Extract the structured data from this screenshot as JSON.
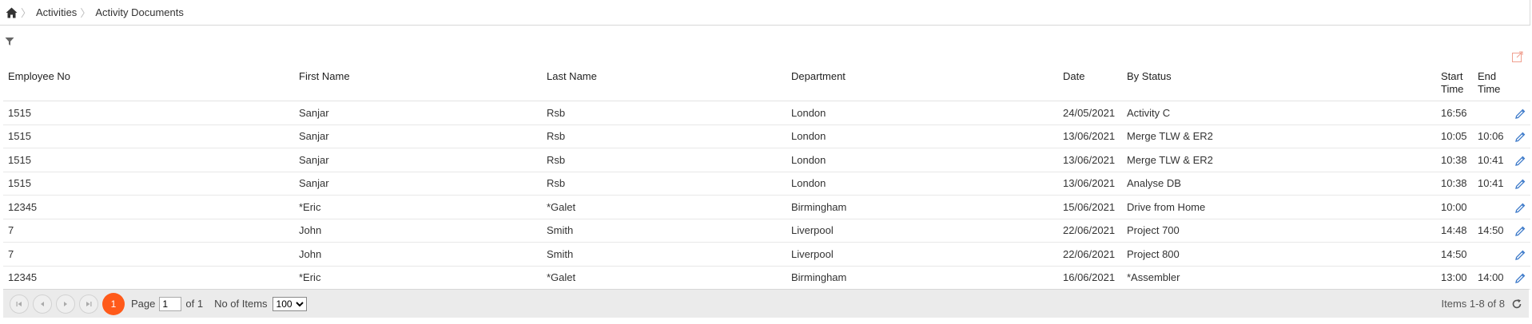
{
  "breadcrumb": {
    "items": [
      "Activities",
      "Activity Documents"
    ]
  },
  "table": {
    "headers": {
      "employee_no": "Employee No",
      "first_name": "First Name",
      "last_name": "Last Name",
      "department": "Department",
      "date": "Date",
      "by_status": "By Status",
      "start_time_1": "Start",
      "start_time_2": "Time",
      "end_time_1": "End",
      "end_time_2": "Time"
    },
    "rows": [
      {
        "emp": "1515",
        "first": "Sanjar",
        "last": "Rsb",
        "dept": "London",
        "date": "24/05/2021",
        "status": "Activity C",
        "start": "16:56",
        "end": ""
      },
      {
        "emp": "1515",
        "first": "Sanjar",
        "last": "Rsb",
        "dept": "London",
        "date": "13/06/2021",
        "status": "Merge TLW & ER2",
        "start": "10:05",
        "end": "10:06"
      },
      {
        "emp": "1515",
        "first": "Sanjar",
        "last": "Rsb",
        "dept": "London",
        "date": "13/06/2021",
        "status": "Merge TLW & ER2",
        "start": "10:38",
        "end": "10:41"
      },
      {
        "emp": "1515",
        "first": "Sanjar",
        "last": "Rsb",
        "dept": "London",
        "date": "13/06/2021",
        "status": "Analyse DB",
        "start": "10:38",
        "end": "10:41"
      },
      {
        "emp": "12345",
        "first": "*Eric",
        "last": "*Galet",
        "dept": "Birmingham",
        "date": "15/06/2021",
        "status": "Drive from Home",
        "start": "10:00",
        "end": ""
      },
      {
        "emp": "7",
        "first": "John",
        "last": "Smith",
        "dept": "Liverpool",
        "date": "22/06/2021",
        "status": "Project 700",
        "start": "14:48",
        "end": "14:50"
      },
      {
        "emp": "7",
        "first": "John",
        "last": "Smith",
        "dept": "Liverpool",
        "date": "22/06/2021",
        "status": "Project 800",
        "start": "14:50",
        "end": ""
      },
      {
        "emp": "12345",
        "first": "*Eric",
        "last": "*Galet",
        "dept": "Birmingham",
        "date": "16/06/2021",
        "status": "*Assembler",
        "start": "13:00",
        "end": "14:00"
      }
    ]
  },
  "pager": {
    "current_page": "1",
    "page_label": "Page",
    "page_value": "1",
    "of_label": "of 1",
    "items_label": "No of Items",
    "page_size": "100",
    "items_info": "Items 1-8 of 8"
  },
  "colors": {
    "accent": "#ff5a1a",
    "edit_icon": "#3a78c9"
  },
  "icons": {
    "home": "home-icon",
    "filter": "filter-icon",
    "export": "export-icon",
    "edit": "pencil-icon",
    "refresh": "refresh-icon"
  }
}
